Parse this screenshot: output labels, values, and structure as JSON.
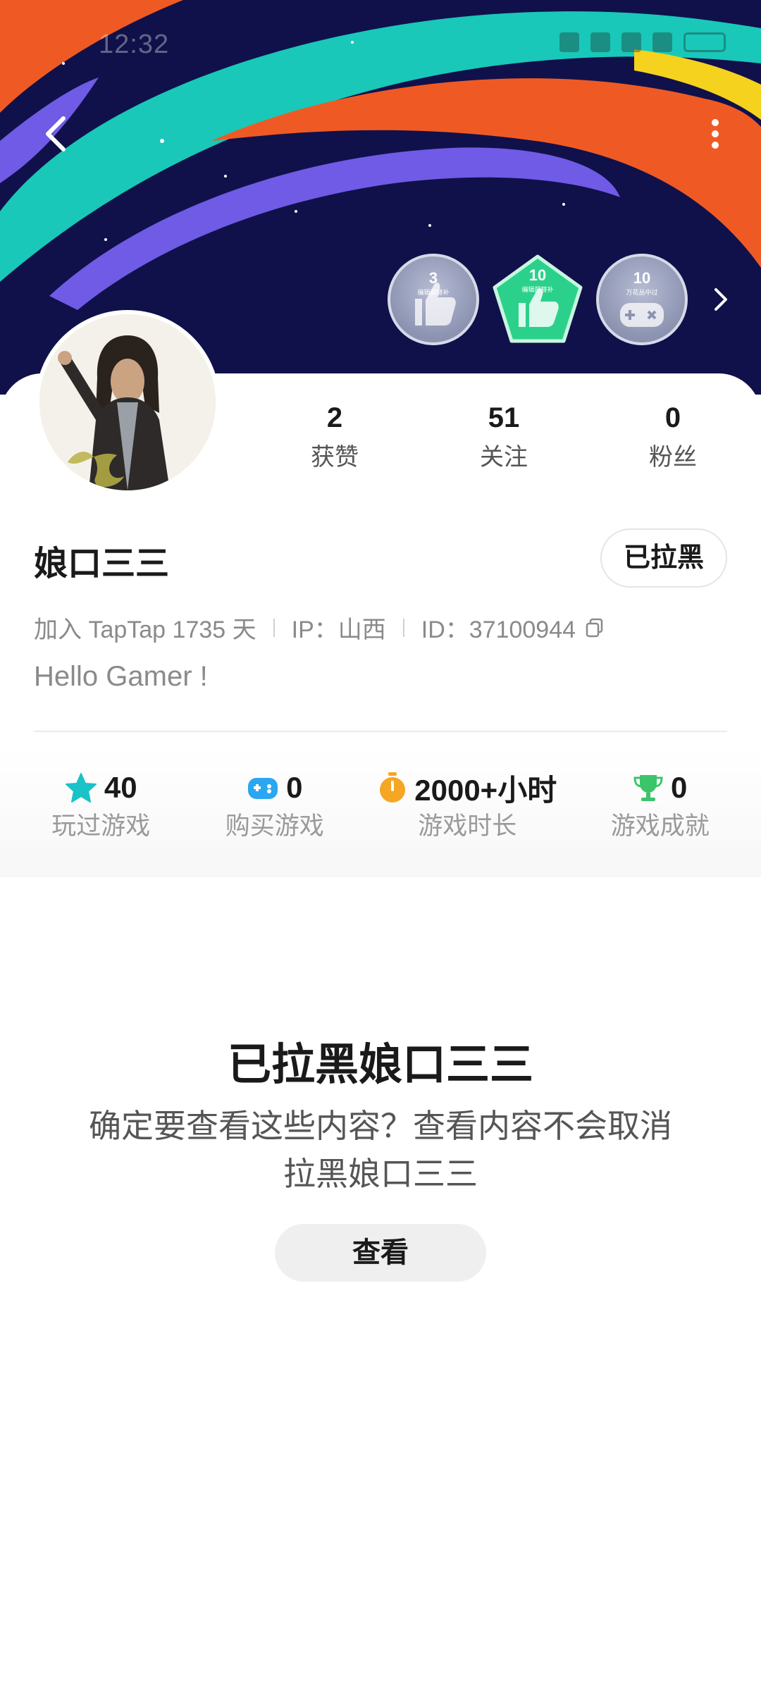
{
  "status_bar": {
    "time": "12:32"
  },
  "badges": [
    {
      "number": "3",
      "caption": "编辑部替补",
      "style": "gray"
    },
    {
      "number": "10",
      "caption": "编辑部替补",
      "style": "green"
    },
    {
      "number": "10",
      "caption": "万花丛中过",
      "style": "gray"
    }
  ],
  "stats": [
    {
      "value": "2",
      "label": "获赞"
    },
    {
      "value": "51",
      "label": "关注"
    },
    {
      "value": "0",
      "label": "粉丝"
    }
  ],
  "profile": {
    "username": "娘口三三",
    "blocked_button": "已拉黑",
    "joined": "加入 TapTap 1735 天",
    "ip": "IP：山西",
    "id": "ID：37100944",
    "bio": "Hello Gamer !"
  },
  "game_stats": [
    {
      "icon": "star-icon",
      "value": "40",
      "label": "玩过游戏",
      "color": "#19c3c8"
    },
    {
      "icon": "gamepad-icon",
      "value": "0",
      "label": "购买游戏",
      "color": "#2aa7f0"
    },
    {
      "icon": "stopwatch-icon",
      "value": "2000+小时",
      "label": "游戏时长",
      "color": "#f5a623"
    },
    {
      "icon": "trophy-icon",
      "value": "0",
      "label": "游戏成就",
      "color": "#3cc46a"
    }
  ],
  "blocked_notice": {
    "title": "已拉黑娘口三三",
    "description": "确定要查看这些内容？查看内容不会取消拉黑娘口三三",
    "view_button": "查看"
  },
  "colors": {
    "banner_bg": "#10114a",
    "teal": "#19c8b8",
    "orange": "#ef5a24",
    "purple": "#6f5be6",
    "yellow": "#f5d21e"
  }
}
